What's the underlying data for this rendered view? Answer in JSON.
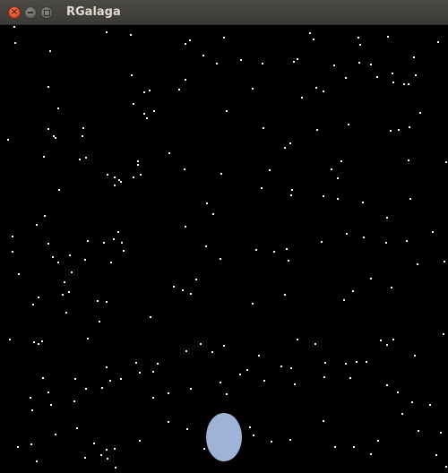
{
  "window": {
    "title": "RGalaga",
    "controls": {
      "close_icon": "close-icon",
      "minimize_icon": "minimize-icon",
      "maximize_icon": "maximize-icon"
    }
  },
  "game": {
    "background_color": "#000000",
    "star_color": "#ffffff",
    "player_ship_color": "#9eb3d6"
  }
}
